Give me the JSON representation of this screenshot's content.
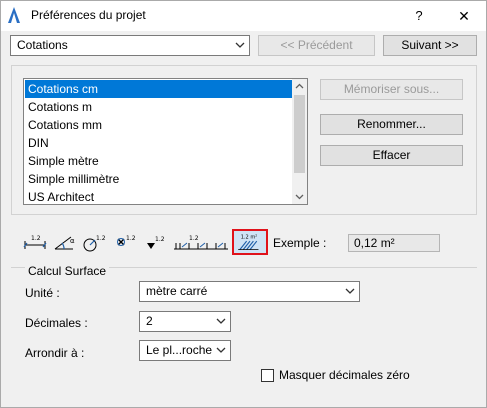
{
  "window": {
    "title": "Préférences du projet",
    "help_label": "?",
    "close_label": "✕"
  },
  "top": {
    "category_select": "Cotations",
    "prev_button": "<< Précédent",
    "next_button": "Suivant >>"
  },
  "list": {
    "items": [
      {
        "label": "Cotations cm",
        "selected": true
      },
      {
        "label": "Cotations m",
        "selected": false
      },
      {
        "label": "Cotations mm",
        "selected": false
      },
      {
        "label": "DIN",
        "selected": false
      },
      {
        "label": "Simple mètre",
        "selected": false
      },
      {
        "label": "Simple millimètre",
        "selected": false
      },
      {
        "label": "US Architect",
        "selected": false
      }
    ]
  },
  "side_buttons": {
    "save_as": "Mémoriser sous...",
    "rename": "Renommer...",
    "delete": "Effacer"
  },
  "toolbar": {
    "tools": [
      {
        "name": "linear-dimension-icon",
        "label": "1.2"
      },
      {
        "name": "angle-dimension-icon",
        "label": "α"
      },
      {
        "name": "radial-dimension-icon",
        "label": "1.2"
      },
      {
        "name": "level-dimension-icon",
        "label": "1.2"
      },
      {
        "name": "elevation-dimension-icon",
        "label": "1.2"
      },
      {
        "name": "door-window-dimension-icon",
        "label": "1.2"
      },
      {
        "name": "area-dimension-icon",
        "label": "1.2 m²"
      }
    ],
    "active_tool": "area-dimension-icon",
    "example_label": "Exemple :",
    "example_value": "0,12 m²"
  },
  "calcul": {
    "title": "Calcul Surface",
    "unit_label": "Unité :",
    "unit_value": "mètre carré",
    "decimals_label": "Décimales :",
    "decimals_value": "2",
    "rounding_label": "Arrondir à :",
    "rounding_value": "Le pl...roche",
    "hide_zero_label": "Masquer décimales zéro",
    "hide_zero_checked": false
  },
  "colors": {
    "selection": "#0078d7",
    "active_tool_border": "#e0121b",
    "accent_icon": "#1f5fa8"
  }
}
